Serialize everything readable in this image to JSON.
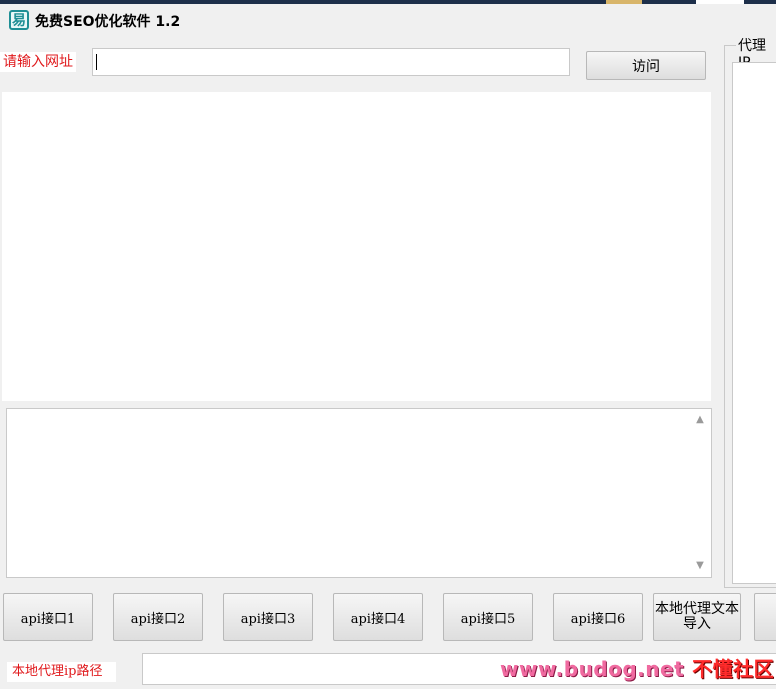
{
  "window": {
    "title": "免费SEO优化软件 1.2",
    "icon": "app-logo-icon",
    "icon_glyph": "易"
  },
  "url_bar": {
    "label": "请输入网址",
    "value": "",
    "visit_button": "访问"
  },
  "proxy_panel": {
    "legend": "代理IP"
  },
  "log": {
    "text": "",
    "scroll_up_icon": "scroll-up-arrow-icon",
    "scroll_down_icon": "scroll-down-arrow-icon"
  },
  "api_buttons": [
    {
      "label": "api接口1"
    },
    {
      "label": "api接口2"
    },
    {
      "label": "api接口3"
    },
    {
      "label": "api接口4"
    },
    {
      "label": "api接口5"
    },
    {
      "label": "api接口6"
    }
  ],
  "local_import_button": "本地代理文本导入",
  "local_path": {
    "label": "本地代理ip路径",
    "value": ""
  },
  "watermark": {
    "site": "www.budog.net",
    "name": "不懂社区"
  },
  "colors": {
    "label_red": "#e0191c",
    "window_bg": "#f0f0f0",
    "icon_teal": "#1f8f95"
  }
}
